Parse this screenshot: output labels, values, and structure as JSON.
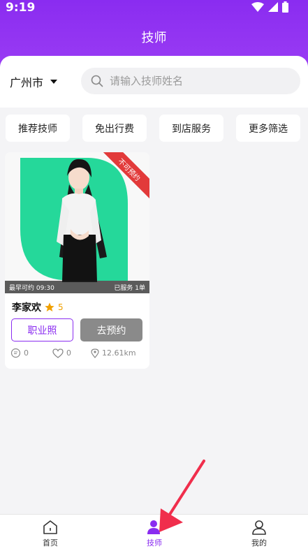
{
  "status_bar": {
    "time": "9:19"
  },
  "header": {
    "title": "技师"
  },
  "filter": {
    "city": "广州市",
    "search_placeholder": "请输入技师姓名"
  },
  "chips": [
    "推荐技师",
    "免出行费",
    "到店服务",
    "更多筛选"
  ],
  "technician": {
    "earliest": "最早可约 09:30",
    "served": "已服务 1单",
    "ribbon": "不可预约",
    "name": "李家欢",
    "rating": "5",
    "license_label": "职业照",
    "book_label": "去预约",
    "comments": "0",
    "likes": "0",
    "distance": "12.61km"
  },
  "tabbar": {
    "home": "首页",
    "technicians": "技师",
    "mine": "我的"
  },
  "colors": {
    "accent": "#8a2cf0",
    "ribbon": "#e23a3a",
    "star": "#f0a000"
  }
}
